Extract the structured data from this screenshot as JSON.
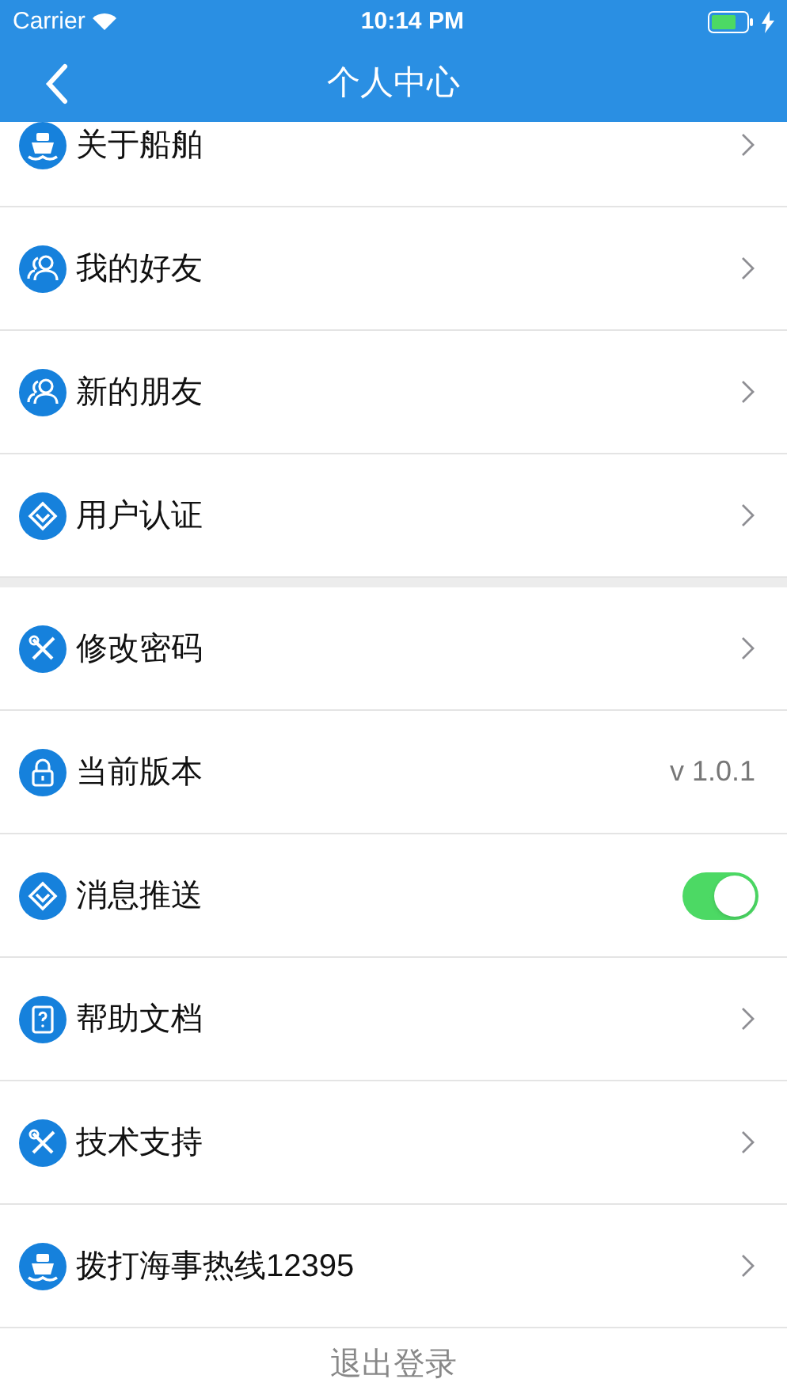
{
  "status_bar": {
    "carrier": "Carrier",
    "time": "10:14 PM",
    "battery": {
      "charging": true
    }
  },
  "nav_bar": {
    "title": "个人中心"
  },
  "sections": [
    {
      "items": [
        {
          "kind": "chevron",
          "label": "关于船舶"
        },
        {
          "kind": "chevron",
          "label": "我的好友"
        },
        {
          "kind": "chevron",
          "label": "新的朋友"
        },
        {
          "kind": "chevron",
          "label": "用户认证"
        }
      ]
    },
    {
      "items": [
        {
          "kind": "chevron",
          "label": "修改密码"
        },
        {
          "kind": "value",
          "label": "当前版本",
          "value": "v 1.0.1"
        },
        {
          "kind": "toggle",
          "label": "消息推送",
          "on": true
        },
        {
          "kind": "chevron",
          "label": "帮助文档"
        },
        {
          "kind": "chevron",
          "label": "技术支持"
        },
        {
          "kind": "chevron",
          "label": "拨打海事热线12395"
        }
      ]
    }
  ],
  "logout": "退出登录"
}
